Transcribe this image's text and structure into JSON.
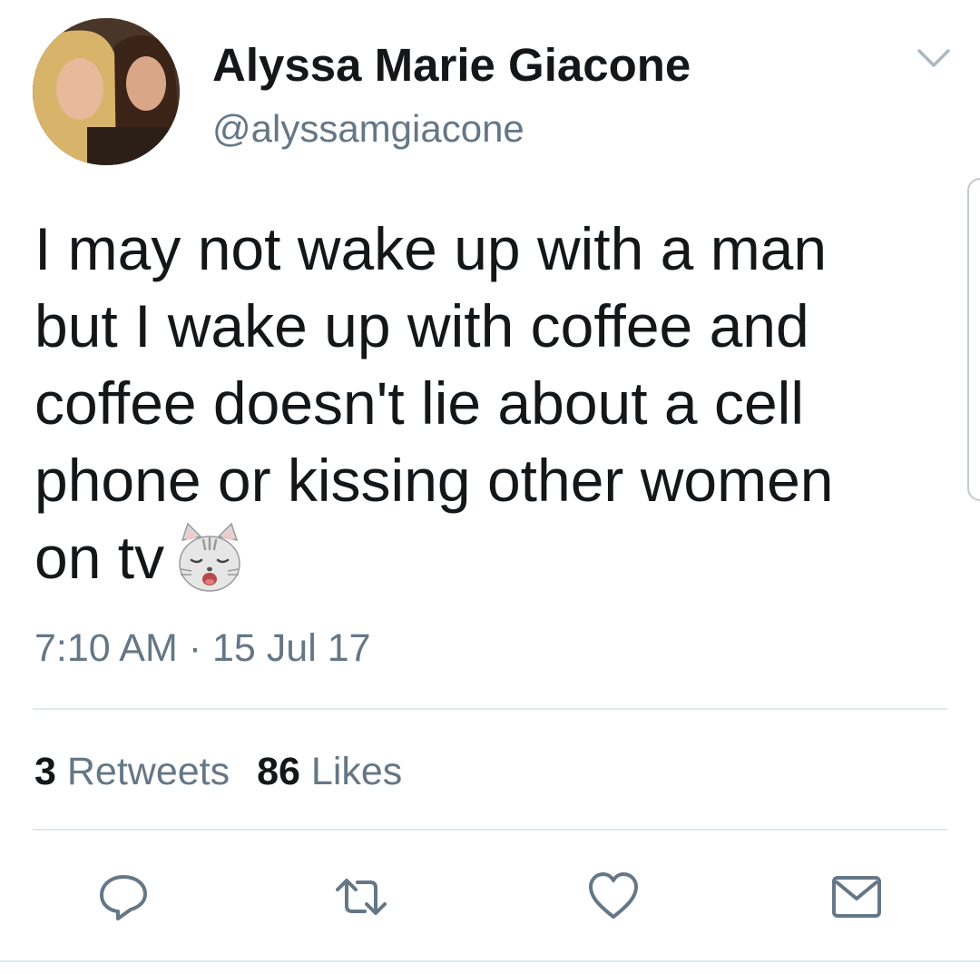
{
  "author": {
    "display_name": "Alyssa Marie Giacone",
    "handle": "@alyssamgiacone",
    "avatar_icon": "profile-photo"
  },
  "tweet": {
    "lines": [
      "I may not wake up with a man",
      "but I wake up with coffee and",
      "coffee doesn't lie about a cell",
      "phone or kissing other women",
      "on tv"
    ],
    "emoji": "weary-cat-face",
    "time": "7:10 AM",
    "separator": "·",
    "date": "15 Jul 17"
  },
  "stats": {
    "retweets_count": "3",
    "retweets_label": "Retweets",
    "likes_count": "86",
    "likes_label": "Likes"
  },
  "actions": {
    "reply_icon": "reply-icon",
    "retweet_icon": "retweet-icon",
    "like_icon": "heart-icon",
    "share_icon": "envelope-icon"
  },
  "colors": {
    "text": "#14171a",
    "secondary": "#657786",
    "divider": "#e1e8ed",
    "background": "#ffffff"
  }
}
